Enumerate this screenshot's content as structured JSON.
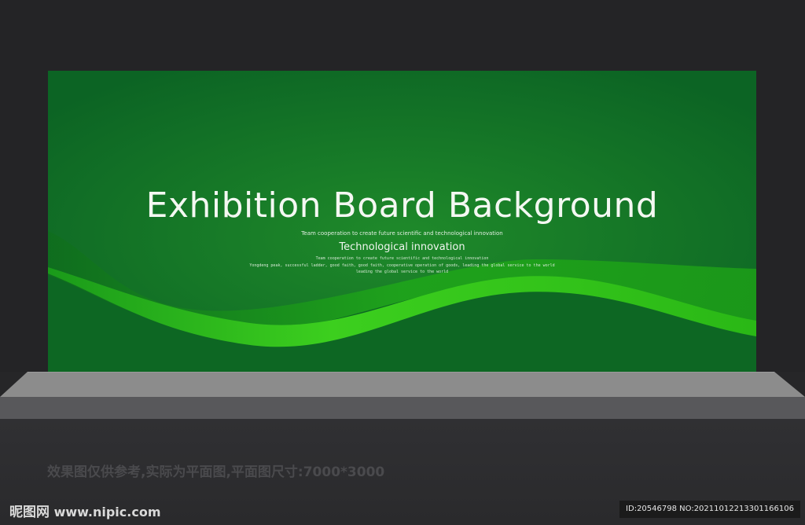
{
  "board": {
    "title": "Exhibition Board Background",
    "tagline_top": "Team cooperation to create future scientific and technological innovation",
    "subtitle": "Technological innovation",
    "tagline_line1": "Team cooperation to create future scientific and technological innovation",
    "tagline_line2": "Yongdeng peak, successful ladder, good faith, good faith, cooperative operation of goods, leading the global service to the world",
    "tagline_line3": "leading the global service to the world"
  },
  "caption": "效果图仅供参考,实际为平面图,平面图尺寸:7000*3000",
  "watermark": {
    "logo_cn": "昵图网",
    "logo_url": "www.nipic.com",
    "id_text": "ID:20546798 NO:20211012213301166106"
  },
  "colors": {
    "board_dark_green": "#0e6a26",
    "wave_bright_green": "#2bc918",
    "stage_background": "#242426",
    "floor_gray": "#8c8c8c"
  }
}
